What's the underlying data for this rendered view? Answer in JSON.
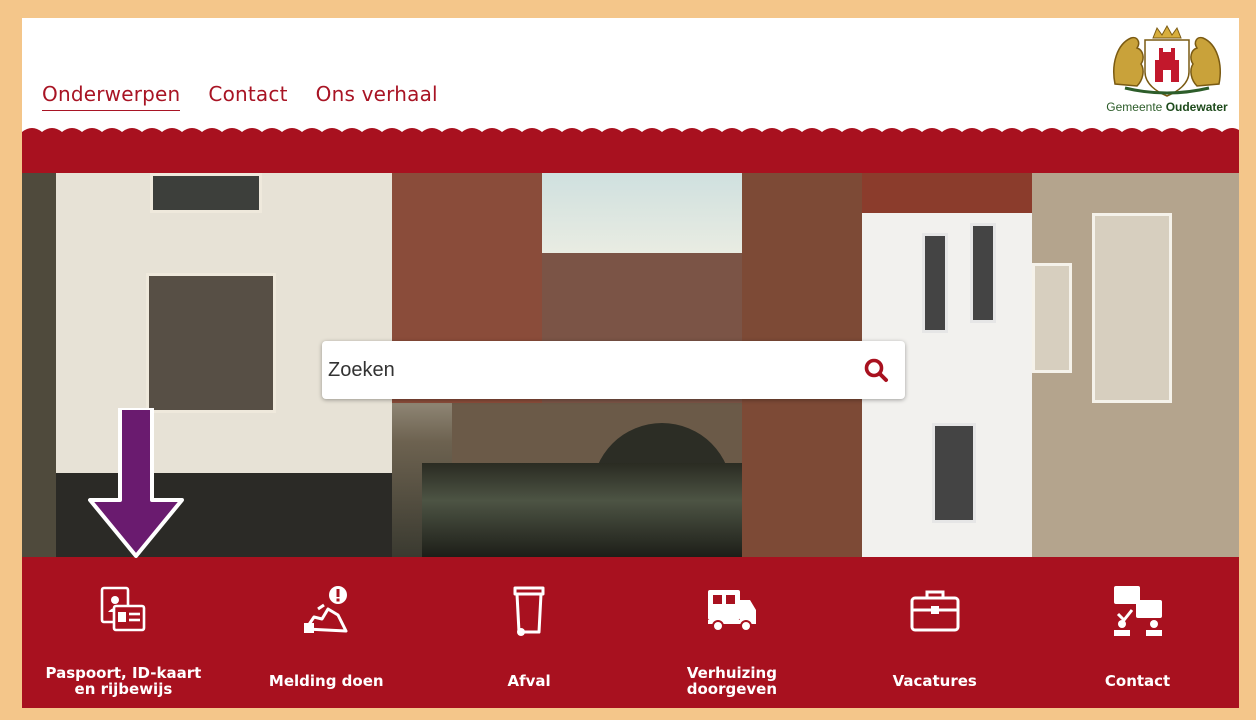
{
  "header": {
    "nav": [
      {
        "label": "Onderwerpen",
        "active": true
      },
      {
        "label": "Contact",
        "active": false
      },
      {
        "label": "Ons verhaal",
        "active": false
      }
    ],
    "logo": {
      "prefix": "Gemeente",
      "name": "Oudewater"
    }
  },
  "search": {
    "placeholder": "Zoeken",
    "icon": "search-icon"
  },
  "tiles": [
    {
      "label": "Paspoort, ID-kaart\nen rijbewijs",
      "icon": "id-card-icon"
    },
    {
      "label": "Melding doen",
      "icon": "report-icon"
    },
    {
      "label": "Afval",
      "icon": "waste-bin-icon"
    },
    {
      "label": "Verhuizing\ndoorgeven",
      "icon": "moving-truck-icon"
    },
    {
      "label": "Vacatures",
      "icon": "briefcase-icon"
    },
    {
      "label": "Contact",
      "icon": "chat-people-icon"
    }
  ],
  "colors": {
    "brand": "#a8111f",
    "frame": "#f4c68a",
    "annotation_arrow": "#6a1b6f",
    "logo_green": "#2d5d2a"
  }
}
